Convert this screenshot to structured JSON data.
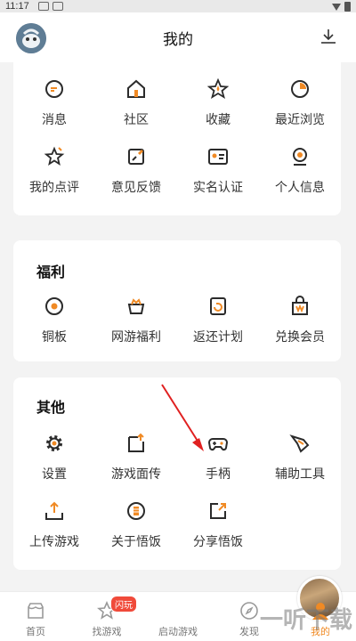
{
  "status_bar": {
    "time": "11:17"
  },
  "header": {
    "title": "我的",
    "avatar": "avatar-image",
    "download_icon": "download-icon"
  },
  "colors": {
    "accent": "#f08a24",
    "icon_dark": "#2b2b2b",
    "background": "#f3f3f3"
  },
  "section_main": {
    "items": [
      {
        "label": "消息",
        "icon": "message-icon"
      },
      {
        "label": "社区",
        "icon": "community-icon"
      },
      {
        "label": "收藏",
        "icon": "favorite-icon"
      },
      {
        "label": "最近浏览",
        "icon": "recent-icon"
      },
      {
        "label": "我的点评",
        "icon": "review-icon"
      },
      {
        "label": "意见反馈",
        "icon": "feedback-icon"
      },
      {
        "label": "实名认证",
        "icon": "id-card-icon"
      },
      {
        "label": "个人信息",
        "icon": "profile-icon"
      }
    ]
  },
  "section_welfare": {
    "title": "福利",
    "items": [
      {
        "label": "铜板",
        "icon": "coin-icon"
      },
      {
        "label": "网游福利",
        "icon": "gift-icon"
      },
      {
        "label": "返还计划",
        "icon": "refund-icon"
      },
      {
        "label": "兑换会员",
        "icon": "vip-bag-icon"
      }
    ]
  },
  "section_other": {
    "title": "其他",
    "items": [
      {
        "label": "设置",
        "icon": "gear-icon"
      },
      {
        "label": "游戏面传",
        "icon": "transfer-icon"
      },
      {
        "label": "手柄",
        "icon": "gamepad-icon"
      },
      {
        "label": "辅助工具",
        "icon": "tool-wing-icon"
      },
      {
        "label": "上传游戏",
        "icon": "upload-icon"
      },
      {
        "label": "关于悟饭",
        "icon": "about-icon"
      },
      {
        "label": "分享悟饭",
        "icon": "share-icon"
      }
    ]
  },
  "bottom_nav": {
    "items": [
      {
        "label": "首页",
        "icon": "home-icon"
      },
      {
        "label": "找游戏",
        "icon": "star-icon",
        "badge": "闪玩"
      },
      {
        "label": "启动游戏",
        "icon": "launch-game-icon"
      },
      {
        "label": "发现",
        "icon": "discover-icon"
      },
      {
        "label": "我的",
        "icon": "user-icon",
        "active": true
      }
    ]
  },
  "watermark": "一听下载"
}
